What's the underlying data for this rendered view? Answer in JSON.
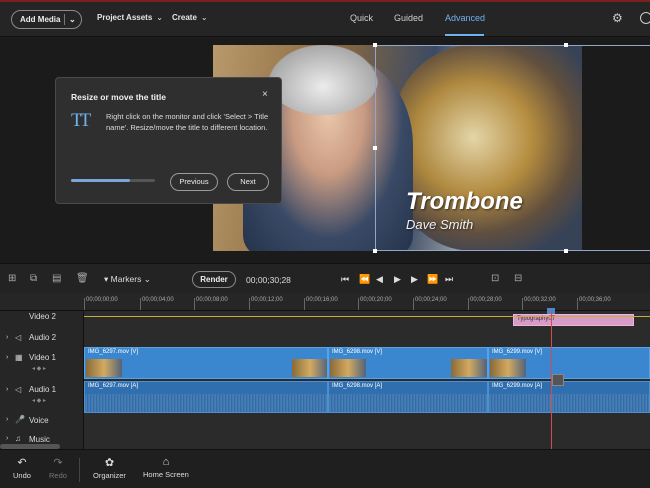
{
  "header": {
    "add_media": "Add Media",
    "project_assets": "Project Assets",
    "create": "Create",
    "tabs": [
      "Quick",
      "Guided",
      "Advanced"
    ],
    "active_tab": "Advanced"
  },
  "monitor": {
    "title_text": "Trombone",
    "subtitle_text": "Dave Smith"
  },
  "tip": {
    "title": "Resize or move the title",
    "close": "×",
    "icon": "TT",
    "body": "Right click on the monitor and click 'Select > Title name'. Resize/move the title to different location.",
    "progress": 0.7,
    "previous": "Previous",
    "next": "Next"
  },
  "timeline_toolbar": {
    "markers": "Markers",
    "render": "Render",
    "timecode": "00;00;30;28"
  },
  "ruler": {
    "labels": [
      "00;00;00;00",
      "00;00;04;00",
      "00;00;08;00",
      "00;00;12;00",
      "00;00;16;00",
      "00;00;20;00",
      "00;00;24;00",
      "00;00;28;00",
      "00;00;32;00",
      "00;00;36;00"
    ]
  },
  "tracks": [
    {
      "name": "Video 2"
    },
    {
      "name": "Audio 2"
    },
    {
      "name": "Video 1"
    },
    {
      "name": "Audio 1"
    },
    {
      "name": "Voice"
    },
    {
      "name": "Music"
    }
  ],
  "clips": {
    "title_clip": "Typography07",
    "video1": [
      "IMG_6297.mov [V]",
      "IMG_6298.mov [V]",
      "IMG_6299.mov [V]"
    ],
    "audio1": [
      "IMG_6297.mov [A]",
      "IMG_6298.mov [A]",
      "IMG_6299.mov [A]"
    ]
  },
  "bottombar": {
    "undo": "Undo",
    "redo": "Redo",
    "organizer": "Organizer",
    "home_screen": "Home Screen"
  },
  "colors": {
    "accent": "#6fb2f0",
    "video_clip": "#3a86cf",
    "title_clip": "#d69bc6",
    "playhead": "#d64b4b"
  }
}
